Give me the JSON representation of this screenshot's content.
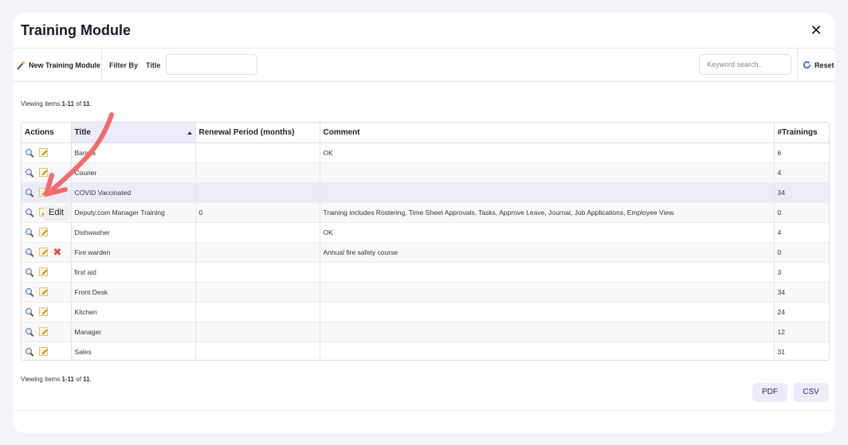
{
  "modal": {
    "title": "Training Module",
    "close_icon": "close-icon"
  },
  "toolbar": {
    "new_label": "New Training Module",
    "filter_by_label": "Filter By",
    "title_label": "Title",
    "title_value": "",
    "search_placeholder": "Keyword search..",
    "reset_label": "Reset"
  },
  "summary": {
    "prefix": "Viewing items ",
    "range": "1-11",
    "of": " of ",
    "total": "11",
    "suffix": "."
  },
  "table": {
    "columns": [
      "Actions",
      "Title",
      "Renewal Period (months)",
      "Comment",
      "#Trainings"
    ],
    "sorted_column": "Title",
    "rows": [
      {
        "title": "Barista",
        "renewal": "",
        "comment": "OK",
        "trainings": "6",
        "deletable": false
      },
      {
        "title": "Courier",
        "renewal": "",
        "comment": "",
        "trainings": "4",
        "deletable": false
      },
      {
        "title": "COVID Vaccinated",
        "renewal": "",
        "comment": "",
        "trainings": "34",
        "deletable": false
      },
      {
        "title": "Deputy.com Manager Training",
        "renewal": "0",
        "comment": "Training includes Rostering, Time Sheet Approvals, Tasks, Approve Leave, Journal, Job Applications, Employee View.",
        "trainings": "0",
        "deletable": false
      },
      {
        "title": "Dishwasher",
        "renewal": "",
        "comment": "OK",
        "trainings": "4",
        "deletable": false
      },
      {
        "title": "Fire warden",
        "renewal": "",
        "comment": "Annual fire safety course",
        "trainings": "0",
        "deletable": true
      },
      {
        "title": "first aid",
        "renewal": "",
        "comment": "",
        "trainings": "3",
        "deletable": false
      },
      {
        "title": "Front Desk",
        "renewal": "",
        "comment": "",
        "trainings": "34",
        "deletable": false
      },
      {
        "title": "Kitchen",
        "renewal": "",
        "comment": "",
        "trainings": "24",
        "deletable": false
      },
      {
        "title": "Manager",
        "renewal": "",
        "comment": "",
        "trainings": "12",
        "deletable": false
      },
      {
        "title": "Sales",
        "renewal": "",
        "comment": "",
        "trainings": "31",
        "deletable": false
      }
    ]
  },
  "tooltip": {
    "text": "Edit"
  },
  "footer": {
    "pdf_label": "PDF",
    "csv_label": "CSV"
  },
  "colors": {
    "accent": "#ecebfa",
    "accent_text": "#2d2a6e",
    "arrow": "#f26b6b",
    "delete": "#e04a4a"
  }
}
